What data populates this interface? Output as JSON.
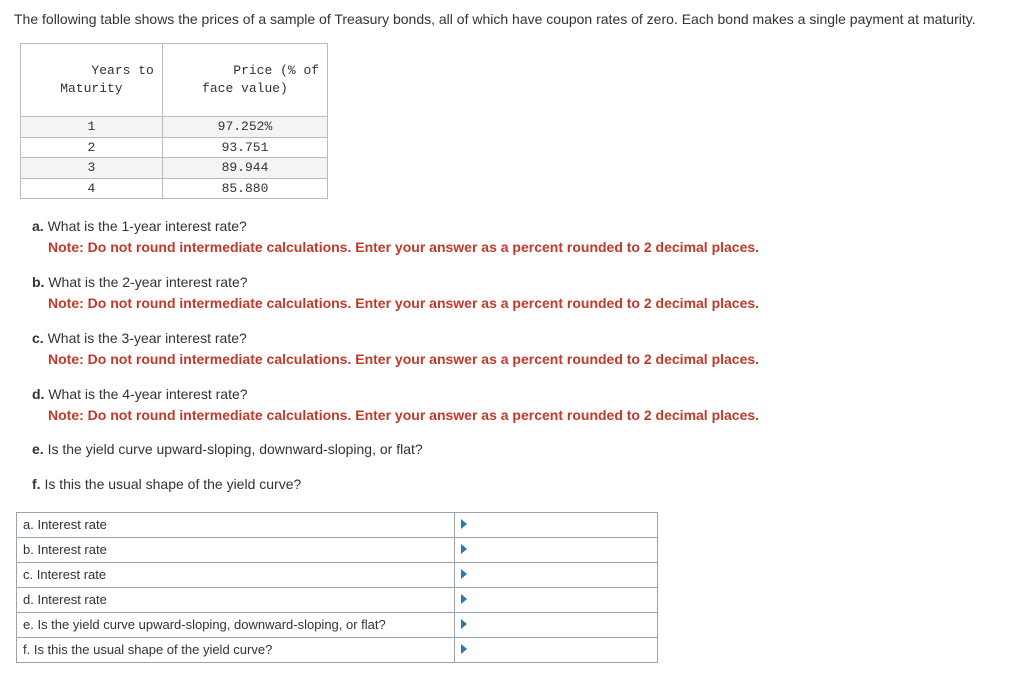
{
  "intro": "The following table shows the prices of a sample of Treasury bonds, all of which have coupon rates of zero. Each bond makes a single payment at maturity.",
  "data_table": {
    "head_col1_line1": "Years to",
    "head_col1_line2": "Maturity",
    "head_col2_line1": "Price (% of",
    "head_col2_line2": "face value)",
    "rows": [
      {
        "y": "1",
        "p": "97.252%"
      },
      {
        "y": "2",
        "p": "93.751"
      },
      {
        "y": "3",
        "p": "89.944"
      },
      {
        "y": "4",
        "p": "85.880"
      }
    ]
  },
  "note_text": "Note: Do not round intermediate calculations. Enter your answer as a percent rounded to 2 decimal places.",
  "questions": {
    "a": {
      "label": "a.",
      "text": "What is the 1-year interest rate?"
    },
    "b": {
      "label": "b.",
      "text": "What is the 2-year interest rate?"
    },
    "c": {
      "label": "c.",
      "text": "What is the 3-year interest rate?"
    },
    "d": {
      "label": "d.",
      "text": "What is the 4-year interest rate?"
    },
    "e": {
      "label": "e.",
      "text": "Is the yield curve upward-sloping, downward-sloping, or flat?"
    },
    "f": {
      "label": "f.",
      "text": "Is this the usual shape of the yield curve?"
    }
  },
  "answers": {
    "a": "a. Interest rate",
    "b": "b. Interest rate",
    "c": "c. Interest rate",
    "d": "d. Interest rate",
    "e": "e. Is the yield curve upward-sloping, downward-sloping, or flat?",
    "f": "f. Is this the usual shape of the yield curve?"
  }
}
